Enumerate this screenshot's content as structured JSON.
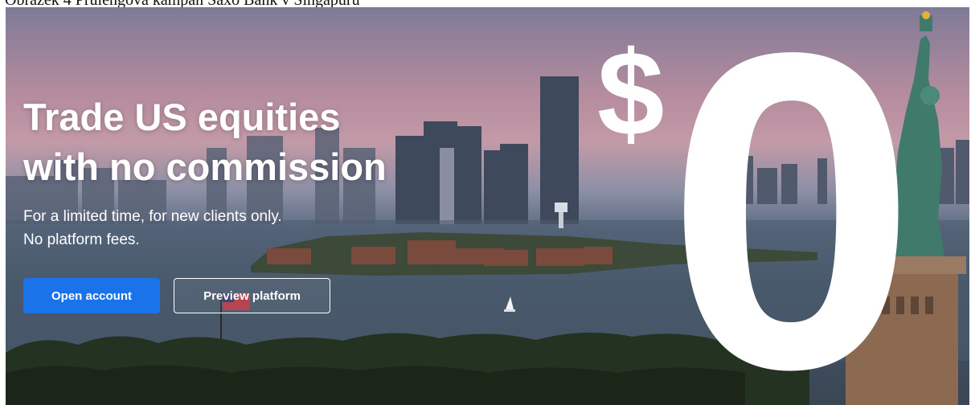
{
  "caption": "Obrázek 4 Průlengová kampaň Saxo Bank v Singapuru",
  "hero": {
    "headline_line1": "Trade US equities",
    "headline_line2": "with no commission",
    "subtext_line1": "For a limited time, for new clients only.",
    "subtext_line2": "No platform fees.",
    "primary_button": "Open account",
    "secondary_button": "Preview platform",
    "price_symbol": "$",
    "price_value": "0"
  },
  "colors": {
    "primary_button": "#1a73e8",
    "text": "#ffffff"
  },
  "icons": [
    "statue-of-liberty-illustration",
    "city-skyline-illustration",
    "sailboat-icon",
    "flag-icon"
  ]
}
